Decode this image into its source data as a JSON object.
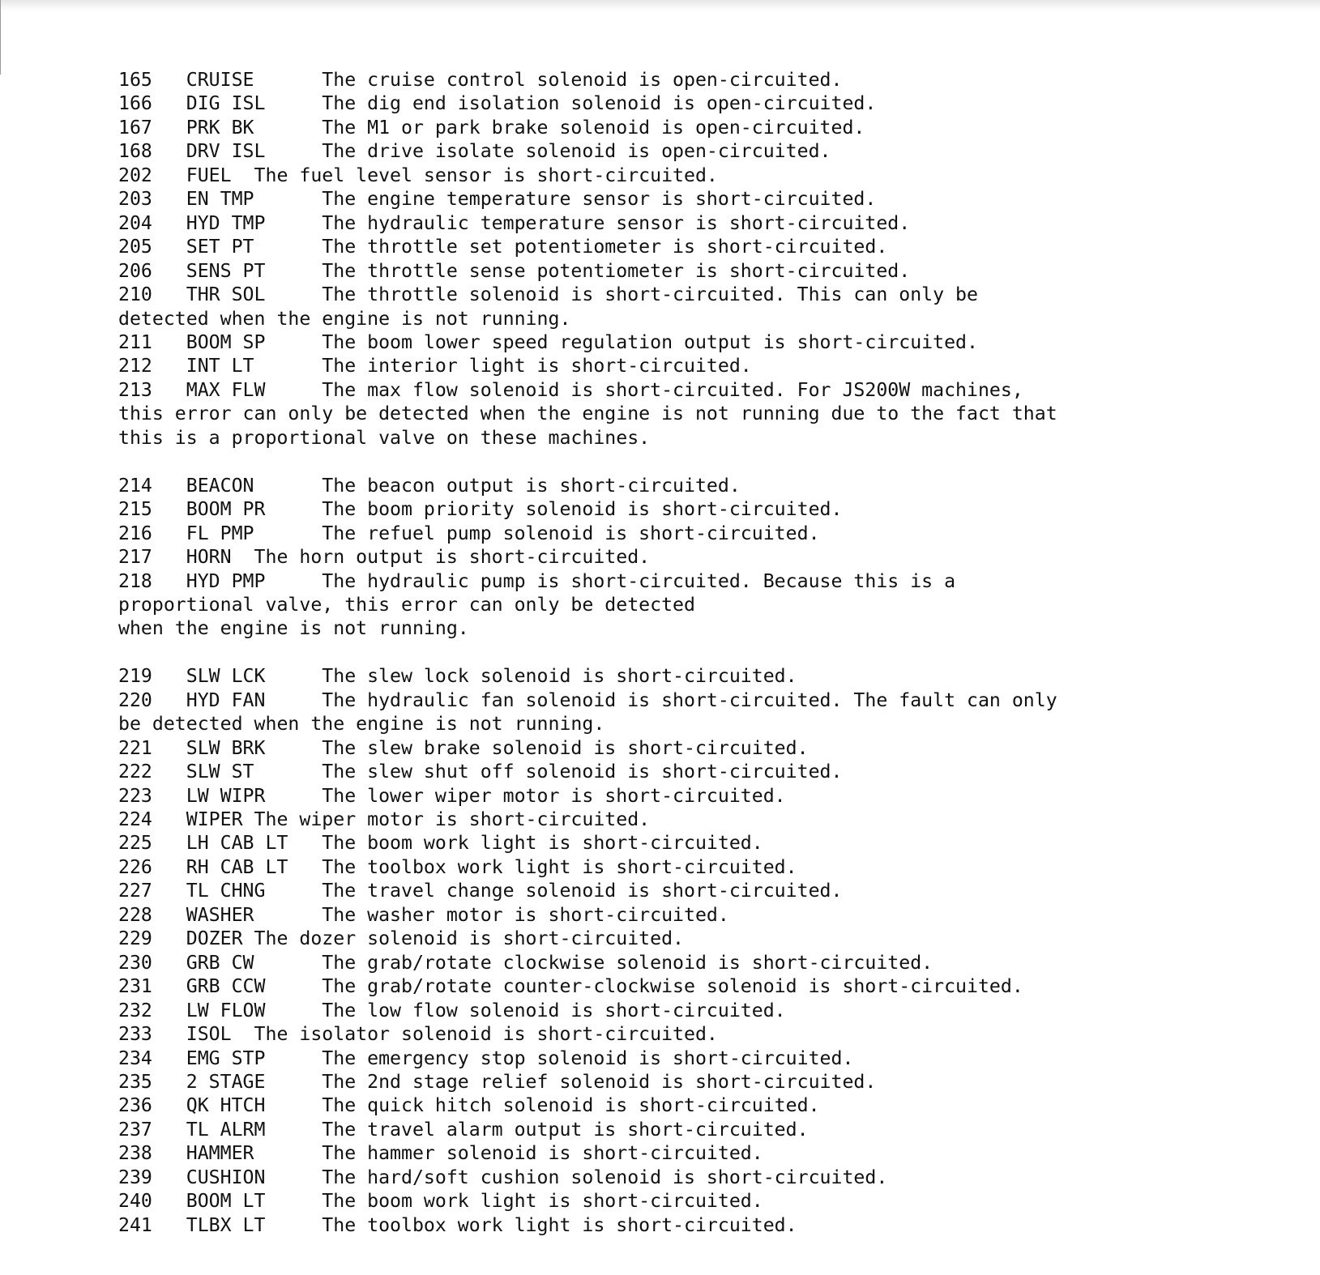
{
  "document": {
    "type": "fault-code-listing",
    "monospace": true,
    "column_layout": {
      "code_column_start_char": 0,
      "name_column_start_char": 6,
      "description_column_start_char": 22
    },
    "entries": [
      {
        "code": "165",
        "name": "CRUISE",
        "description": "The cruise control solenoid is open-circuited."
      },
      {
        "code": "166",
        "name": "DIG ISL",
        "description": "The dig end isolation solenoid is open-circuited."
      },
      {
        "code": "167",
        "name": "PRK BK",
        "description": "The M1 or park brake solenoid is open-circuited."
      },
      {
        "code": "168",
        "name": "DRV ISL",
        "description": "The drive isolate solenoid is open-circuited."
      },
      {
        "code": "202",
        "name": "FUEL",
        "description": "The fuel level sensor is short-circuited."
      },
      {
        "code": "203",
        "name": "EN TMP",
        "description": "The engine temperature sensor is short-circuited."
      },
      {
        "code": "204",
        "name": "HYD TMP",
        "description": "The hydraulic temperature sensor is short-circuited."
      },
      {
        "code": "205",
        "name": "SET PT",
        "description": "The throttle set potentiometer is short-circuited."
      },
      {
        "code": "206",
        "name": "SENS PT",
        "description": "The throttle sense potentiometer is short-circuited."
      },
      {
        "code": "210",
        "name": "THR SOL",
        "description": "The throttle solenoid is short-circuited. This can only be detected when the engine is not running."
      },
      {
        "code": "211",
        "name": "BOOM SP",
        "description": "The boom lower speed regulation output is short-circuited."
      },
      {
        "code": "212",
        "name": "INT LT",
        "description": "The interior light is short-circuited."
      },
      {
        "code": "213",
        "name": "MAX FLW",
        "description": "The max flow solenoid is short-circuited. For JS200W machines, this error can only be detected when the engine is not running due to the fact that this is a proportional valve on these machines."
      },
      {
        "code": "214",
        "name": "BEACON",
        "description": "The beacon output is short-circuited."
      },
      {
        "code": "215",
        "name": "BOOM PR",
        "description": "The boom priority solenoid is short-circuited."
      },
      {
        "code": "216",
        "name": "FL PMP",
        "description": "The refuel pump solenoid is short-circuited."
      },
      {
        "code": "217",
        "name": "HORN",
        "description": "The horn output is short-circuited."
      },
      {
        "code": "218",
        "name": "HYD PMP",
        "description": "The hydraulic pump is short-circuited. Because this is a proportional valve, this error can only be detected when the engine is not running."
      },
      {
        "code": "219",
        "name": "SLW LCK",
        "description": "The slew lock solenoid is short-circuited."
      },
      {
        "code": "220",
        "name": "HYD FAN",
        "description": "The hydraulic fan solenoid is short-circuited. The fault can only be detected when the engine is not running."
      },
      {
        "code": "221",
        "name": "SLW BRK",
        "description": "The slew brake solenoid is short-circuited."
      },
      {
        "code": "222",
        "name": "SLW ST",
        "description": "The slew shut off solenoid is short-circuited."
      },
      {
        "code": "223",
        "name": "LW WIPR",
        "description": "The lower wiper motor is short-circuited."
      },
      {
        "code": "224",
        "name": "WIPER",
        "description": "The wiper motor is short-circuited."
      },
      {
        "code": "225",
        "name": "LH CAB LT",
        "description": "The boom work light is short-circuited."
      },
      {
        "code": "226",
        "name": "RH CAB LT",
        "description": "The toolbox work light is short-circuited."
      },
      {
        "code": "227",
        "name": "TL CHNG",
        "description": "The travel change solenoid is short-circuited."
      },
      {
        "code": "228",
        "name": "WASHER",
        "description": "The washer motor is short-circuited."
      },
      {
        "code": "229",
        "name": "DOZER",
        "description": "The dozer solenoid is short-circuited."
      },
      {
        "code": "230",
        "name": "GRB CW",
        "description": "The grab/rotate clockwise solenoid is short-circuited."
      },
      {
        "code": "231",
        "name": "GRB CCW",
        "description": "The grab/rotate counter-clockwise solenoid is short-circuited."
      },
      {
        "code": "232",
        "name": "LW FLOW",
        "description": "The low flow solenoid is short-circuited."
      },
      {
        "code": "233",
        "name": "ISOL",
        "description": "The isolator solenoid is short-circuited."
      },
      {
        "code": "234",
        "name": "EMG STP",
        "description": "The emergency stop solenoid is short-circuited."
      },
      {
        "code": "235",
        "name": "2 STAGE",
        "description": "The 2nd stage relief solenoid is short-circuited."
      },
      {
        "code": "236",
        "name": "QK HTCH",
        "description": "The quick hitch solenoid is short-circuited."
      },
      {
        "code": "237",
        "name": "TL ALRM",
        "description": "The travel alarm output is short-circuited."
      },
      {
        "code": "238",
        "name": "HAMMER",
        "description": "The hammer solenoid is short-circuited."
      },
      {
        "code": "239",
        "name": "CUSHION",
        "description": "The hard/soft cushion solenoid is short-circuited."
      },
      {
        "code": "240",
        "name": "BOOM LT",
        "description": "The boom work light is short-circuited."
      },
      {
        "code": "241",
        "name": "TLBX LT",
        "description": "The toolbox work light is short-circuited."
      }
    ],
    "lines": [
      "165   CRUISE      The cruise control solenoid is open-circuited.",
      "166   DIG ISL     The dig end isolation solenoid is open-circuited.",
      "167   PRK BK      The M1 or park brake solenoid is open-circuited.",
      "168   DRV ISL     The drive isolate solenoid is open-circuited.",
      "202   FUEL  The fuel level sensor is short-circuited.",
      "203   EN TMP      The engine temperature sensor is short-circuited.",
      "204   HYD TMP     The hydraulic temperature sensor is short-circuited.",
      "205   SET PT      The throttle set potentiometer is short-circuited.",
      "206   SENS PT     The throttle sense potentiometer is short-circuited.",
      "210   THR SOL     The throttle solenoid is short-circuited. This can only be",
      "detected when the engine is not running.",
      "211   BOOM SP     The boom lower speed regulation output is short-circuited.",
      "212   INT LT      The interior light is short-circuited.",
      "213   MAX FLW     The max flow solenoid is short-circuited. For JS200W machines,",
      "this error can only be detected when the engine is not running due to the fact that",
      "this is a proportional valve on these machines.",
      "",
      "214   BEACON      The beacon output is short-circuited.",
      "215   BOOM PR     The boom priority solenoid is short-circuited.",
      "216   FL PMP      The refuel pump solenoid is short-circuited.",
      "217   HORN  The horn output is short-circuited.",
      "218   HYD PMP     The hydraulic pump is short-circuited. Because this is a",
      "proportional valve, this error can only be detected",
      "when the engine is not running.",
      "",
      "219   SLW LCK     The slew lock solenoid is short-circuited.",
      "220   HYD FAN     The hydraulic fan solenoid is short-circuited. The fault can only",
      "be detected when the engine is not running.",
      "221   SLW BRK     The slew brake solenoid is short-circuited.",
      "222   SLW ST      The slew shut off solenoid is short-circuited.",
      "223   LW WIPR     The lower wiper motor is short-circuited.",
      "224   WIPER The wiper motor is short-circuited.",
      "225   LH CAB LT   The boom work light is short-circuited.",
      "226   RH CAB LT   The toolbox work light is short-circuited.",
      "227   TL CHNG     The travel change solenoid is short-circuited.",
      "228   WASHER      The washer motor is short-circuited.",
      "229   DOZER The dozer solenoid is short-circuited.",
      "230   GRB CW      The grab/rotate clockwise solenoid is short-circuited.",
      "231   GRB CCW     The grab/rotate counter-clockwise solenoid is short-circuited.",
      "232   LW FLOW     The low flow solenoid is short-circuited.",
      "233   ISOL  The isolator solenoid is short-circuited.",
      "234   EMG STP     The emergency stop solenoid is short-circuited.",
      "235   2 STAGE     The 2nd stage relief solenoid is short-circuited.",
      "236   QK HTCH     The quick hitch solenoid is short-circuited.",
      "237   TL ALRM     The travel alarm output is short-circuited.",
      "238   HAMMER      The hammer solenoid is short-circuited.",
      "239   CUSHION     The hard/soft cushion solenoid is short-circuited.",
      "240   BOOM LT     The boom work light is short-circuited.",
      "241   TLBX LT     The toolbox work light is short-circuited."
    ]
  }
}
